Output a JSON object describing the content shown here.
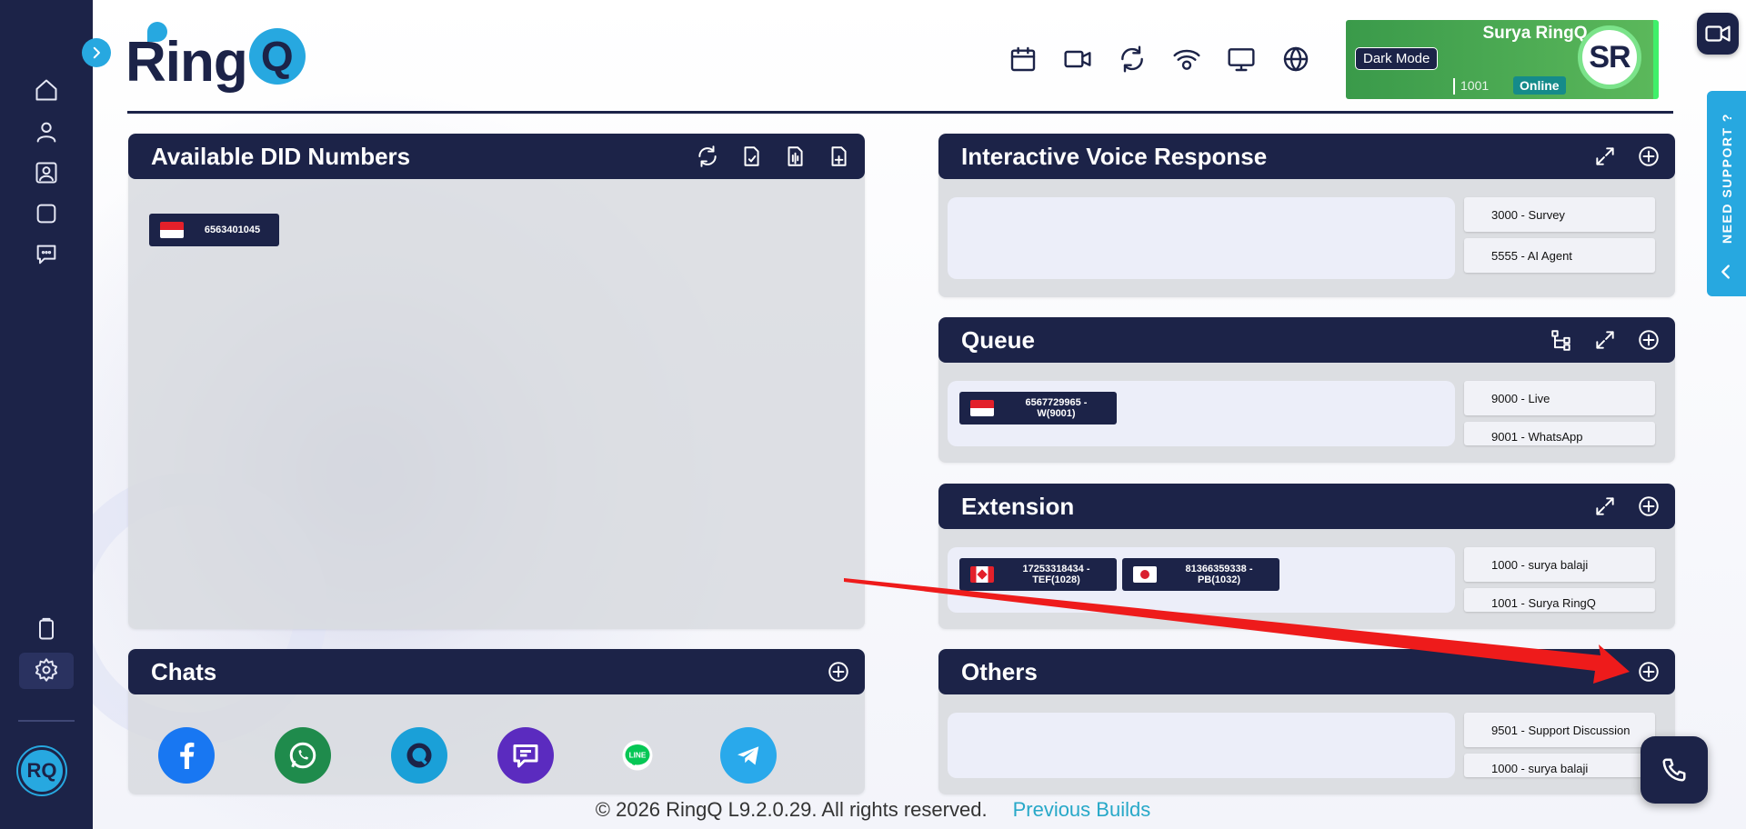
{
  "brand": {
    "name": "RingQ",
    "name_main": "Ring",
    "name_q": "Q"
  },
  "user": {
    "name": "Surya RingQ",
    "initials": "SR",
    "extension": "1001",
    "status": "Online",
    "dark_mode_label": "Dark Mode"
  },
  "support_label": "NEED SUPPORT ?",
  "top_icons": [
    "calendar-icon",
    "video-camera-icon",
    "refresh-icon",
    "wifi-icon",
    "monitor-icon",
    "globe-icon"
  ],
  "sidebar_icons": [
    "home-icon",
    "user-icon",
    "contact-card-icon",
    "square-icon",
    "chat-bubble-icon",
    "clipboard-icon",
    "gear-icon"
  ],
  "panels": {
    "did": {
      "title": "Available DID Numbers",
      "numbers": [
        {
          "flag": "SG",
          "number": "6563401045"
        }
      ]
    },
    "ivr": {
      "title": "Interactive Voice Response",
      "items": [
        "3000 - Survey",
        "5555 - AI Agent"
      ]
    },
    "queue": {
      "title": "Queue",
      "chips": [
        {
          "flag": "SG",
          "line1": "6567729965 -",
          "line2": "W(9001)"
        }
      ],
      "items": [
        "9000 - Live",
        "9001 - WhatsApp"
      ]
    },
    "extension": {
      "title": "Extension",
      "chips": [
        {
          "flag": "CA",
          "line1": "17253318434 -",
          "line2": "TEF(1028)"
        },
        {
          "flag": "JP",
          "line1": "81366359338 -",
          "line2": "PB(1032)"
        }
      ],
      "items": [
        "1000 - surya balaji",
        "1001 - Surya RingQ"
      ]
    },
    "chats": {
      "title": "Chats",
      "channels": [
        "facebook-icon",
        "whatsapp-icon",
        "ringq-chat-icon",
        "sms-icon",
        "line-icon",
        "telegram-icon"
      ],
      "line_label": "LINE"
    },
    "others": {
      "title": "Others",
      "items": [
        "9501 - Support Discussion",
        "1000 - surya balaji"
      ]
    }
  },
  "footer": {
    "copyright": "© 2026 RingQ L9.2.0.29. All rights reserved.",
    "link": "Previous Builds"
  },
  "colors": {
    "navy": "#1c2348",
    "accent": "#27a8e0",
    "online": "#158b8a",
    "user_card": "#4caa50",
    "annotation_arrow": "#ee1b1b"
  }
}
